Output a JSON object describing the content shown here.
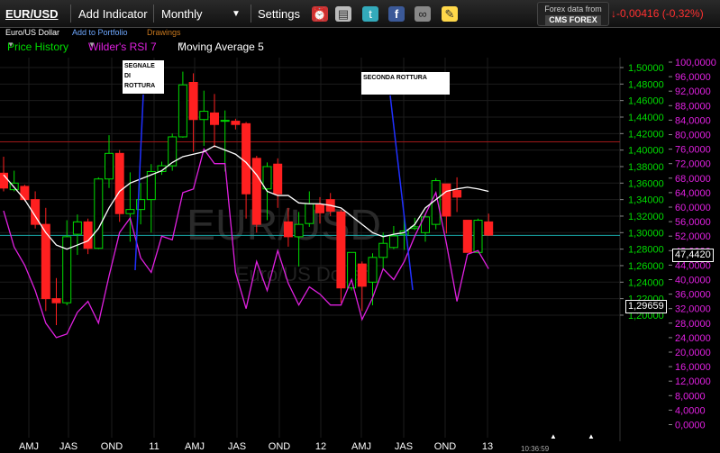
{
  "toolbar": {
    "symbol": "EUR/USD",
    "add_indicator": "Add Indicator",
    "period": "Monthly",
    "settings": "Settings",
    "provider_line1": "Forex data from",
    "provider_line2": "CMS FOREX",
    "change": "-0,00416 (-0,32%)"
  },
  "subbar": {
    "name": "Euro/US Dollar",
    "add_portfolio": "Add to Portfolio",
    "drawings": "Drawings"
  },
  "indicators": {
    "price_history": "Price History",
    "rsi": "Wilder's RSI 7",
    "ma": "Moving Average 5"
  },
  "notes": {
    "first": "SEGNALE DI ROTTURA",
    "second": "SECONDA ROTTURA"
  },
  "watermark": {
    "main": "EUR/USD",
    "sub": "Euro/US Dollar"
  },
  "price_axis": [
    "1,50000",
    "1,48000",
    "1,46000",
    "1,44000",
    "1,42000",
    "1,40000",
    "1,38000",
    "1,36000",
    "1,34000",
    "1,32000",
    "1,30000",
    "1,28000",
    "1,26000",
    "1,24000",
    "1,22000",
    "1,20000"
  ],
  "rsi_axis": [
    "100,0000",
    "96,0000",
    "92,0000",
    "88,0000",
    "84,0000",
    "80,0000",
    "76,0000",
    "72,0000",
    "68,0000",
    "64,0000",
    "60,0000",
    "56,0000",
    "52,0000",
    "48,0000",
    "44,0000",
    "40,0000",
    "36,0000",
    "32,0000",
    "28,0000",
    "24,0000",
    "20,0000",
    "16,0000",
    "12,0000",
    "8,0000",
    "4,0000",
    "0,0000"
  ],
  "x_axis": [
    "AMJ",
    "JAS",
    "OND",
    "11",
    "AMJ",
    "JAS",
    "OND",
    "12",
    "AMJ",
    "JAS",
    "OND",
    "13"
  ],
  "current_price": "1,29659",
  "current_rsi": "47,4420",
  "time_label": "10:36:59",
  "colors": {
    "up": "#00dd00",
    "down": "#ff2020",
    "rsi": "#e020e0",
    "ma": "#ffffff",
    "price_axis": "#00dd00",
    "rsi_axis": "#e020e0"
  },
  "chart_data": {
    "type": "candlestick",
    "candles": [
      {
        "o": 1.372,
        "h": 1.392,
        "l": 1.35,
        "c": 1.354
      },
      {
        "o": 1.352,
        "h": 1.375,
        "l": 1.35,
        "c": 1.36
      },
      {
        "o": 1.356,
        "h": 1.358,
        "l": 1.338,
        "c": 1.34
      },
      {
        "o": 1.34,
        "h": 1.35,
        "l": 1.305,
        "c": 1.31
      },
      {
        "o": 1.31,
        "h": 1.33,
        "l": 1.205,
        "c": 1.22
      },
      {
        "o": 1.22,
        "h": 1.245,
        "l": 1.188,
        "c": 1.215
      },
      {
        "o": 1.215,
        "h": 1.315,
        "l": 1.212,
        "c": 1.295
      },
      {
        "o": 1.298,
        "h": 1.322,
        "l": 1.273,
        "c": 1.313
      },
      {
        "o": 1.313,
        "h": 1.317,
        "l": 1.274,
        "c": 1.281
      },
      {
        "o": 1.281,
        "h": 1.367,
        "l": 1.28,
        "c": 1.365
      },
      {
        "o": 1.365,
        "h": 1.418,
        "l": 1.354,
        "c": 1.396
      },
      {
        "o": 1.396,
        "h": 1.4,
        "l": 1.313,
        "c": 1.323
      },
      {
        "o": 1.323,
        "h": 1.373,
        "l": 1.289,
        "c": 1.328
      },
      {
        "o": 1.328,
        "h": 1.36,
        "l": 1.31,
        "c": 1.34
      },
      {
        "o": 1.34,
        "h": 1.383,
        "l": 1.3,
        "c": 1.374
      },
      {
        "o": 1.374,
        "h": 1.386,
        "l": 1.37,
        "c": 1.381
      },
      {
        "o": 1.381,
        "h": 1.42,
        "l": 1.375,
        "c": 1.416
      },
      {
        "o": 1.416,
        "h": 1.495,
        "l": 1.415,
        "c": 1.479
      },
      {
        "o": 1.482,
        "h": 1.493,
        "l": 1.398,
        "c": 1.437
      },
      {
        "o": 1.437,
        "h": 1.472,
        "l": 1.405,
        "c": 1.447
      },
      {
        "o": 1.445,
        "h": 1.468,
        "l": 1.403,
        "c": 1.431
      },
      {
        "o": 1.436,
        "h": 1.448,
        "l": 1.374,
        "c": 1.436
      },
      {
        "o": 1.435,
        "h": 1.438,
        "l": 1.425,
        "c": 1.431
      },
      {
        "o": 1.432,
        "h": 1.434,
        "l": 1.317,
        "c": 1.347
      },
      {
        "o": 1.39,
        "h": 1.393,
        "l": 1.3,
        "c": 1.31
      },
      {
        "o": 1.353,
        "h": 1.385,
        "l": 1.315,
        "c": 1.38
      },
      {
        "o": 1.383,
        "h": 1.39,
        "l": 1.33,
        "c": 1.347
      },
      {
        "o": 1.313,
        "h": 1.33,
        "l": 1.283,
        "c": 1.295
      },
      {
        "o": 1.295,
        "h": 1.325,
        "l": 1.259,
        "c": 1.31
      },
      {
        "o": 1.311,
        "h": 1.35,
        "l": 1.307,
        "c": 1.335
      },
      {
        "o": 1.334,
        "h": 1.343,
        "l": 1.311,
        "c": 1.324
      },
      {
        "o": 1.34,
        "h": 1.348,
        "l": 1.32,
        "c": 1.326
      },
      {
        "o": 1.325,
        "h": 1.328,
        "l": 1.215,
        "c": 1.233
      },
      {
        "o": 1.233,
        "h": 1.262,
        "l": 1.23,
        "c": 1.276
      },
      {
        "o": 1.262,
        "h": 1.265,
        "l": 1.205,
        "c": 1.235
      },
      {
        "o": 1.24,
        "h": 1.275,
        "l": 1.212,
        "c": 1.27
      },
      {
        "o": 1.27,
        "h": 1.3,
        "l": 1.256,
        "c": 1.287
      },
      {
        "o": 1.282,
        "h": 1.308,
        "l": 1.28,
        "c": 1.296
      },
      {
        "o": 1.298,
        "h": 1.318,
        "l": 1.279,
        "c": 1.302
      },
      {
        "o": 1.305,
        "h": 1.318,
        "l": 1.303,
        "c": 1.307
      },
      {
        "o": 1.3,
        "h": 1.322,
        "l": 1.289,
        "c": 1.319
      },
      {
        "o": 1.31,
        "h": 1.366,
        "l": 1.304,
        "c": 1.363
      },
      {
        "o": 1.359,
        "h": 1.359,
        "l": 1.299,
        "c": 1.32
      },
      {
        "o": 1.351,
        "h": 1.367,
        "l": 1.325,
        "c": 1.343
      },
      {
        "o": 1.315,
        "h": 1.315,
        "l": 1.276,
        "c": 1.276
      },
      {
        "o": 1.276,
        "h": 1.317,
        "l": 1.275,
        "c": 1.315
      },
      {
        "o": 1.313,
        "h": 1.323,
        "l": 1.296,
        "c": 1.297
      }
    ],
    "rsi": [
      59,
      49,
      44,
      37,
      28,
      24,
      25,
      31,
      34,
      28,
      41,
      53,
      57,
      46,
      42,
      52,
      51,
      64,
      65,
      76,
      72,
      72,
      42,
      32,
      45,
      37,
      48,
      39,
      33,
      38,
      36,
      33,
      33,
      40,
      29,
      35,
      43,
      40,
      45,
      52,
      58,
      64,
      50,
      34,
      47,
      48,
      43
    ],
    "ma": [
      1.37,
      1.355,
      1.34,
      1.32,
      1.3,
      1.285,
      1.28,
      1.285,
      1.29,
      1.305,
      1.33,
      1.35,
      1.36,
      1.365,
      1.37,
      1.375,
      1.385,
      1.392,
      1.395,
      1.398,
      1.405,
      1.4,
      1.395,
      1.385,
      1.37,
      1.35,
      1.345,
      1.345,
      1.336,
      1.335,
      1.335,
      1.333,
      1.33,
      1.32,
      1.31,
      1.3,
      1.295,
      1.298,
      1.3,
      1.31,
      1.33,
      1.34,
      1.35,
      1.353,
      1.355,
      1.353,
      1.35
    ],
    "price_range": [
      1.19,
      1.51
    ],
    "rsi_range": [
      0,
      100
    ],
    "hlines": {
      "red": 1.41,
      "cyan": 1.29659
    }
  }
}
